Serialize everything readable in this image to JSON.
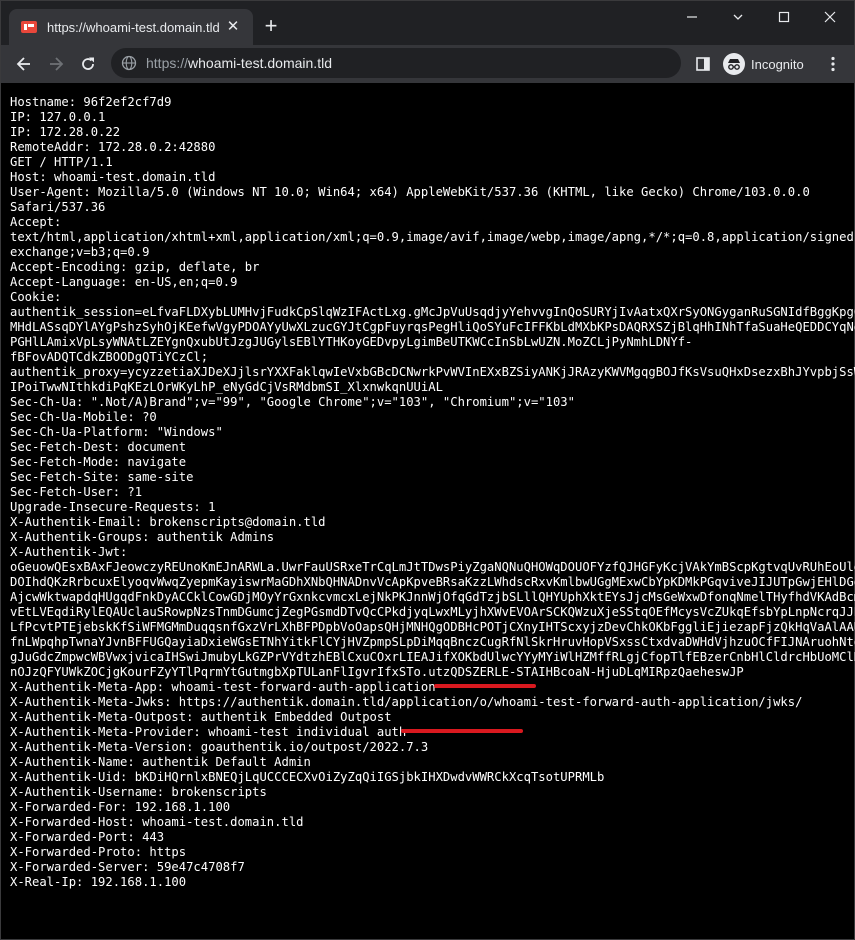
{
  "browser": {
    "tab_title": "https://whoami-test.domain.tld",
    "url_scheme": "https://",
    "url_host": "whoami-test.domain.tld",
    "profile_label": "Incognito",
    "accent_highlight": "#d9191f"
  },
  "response_lines": [
    "Hostname: 96f2ef2cf7d9",
    "IP: 127.0.0.1",
    "IP: 172.28.0.22",
    "RemoteAddr: 172.28.0.2:42880",
    "GET / HTTP/1.1",
    "Host: whoami-test.domain.tld",
    "User-Agent: Mozilla/5.0 (Windows NT 10.0; Win64; x64) AppleWebKit/537.36 (KHTML, like Gecko) Chrome/103.0.0.0",
    "Safari/537.36",
    "Accept:",
    "text/html,application/xhtml+xml,application/xml;q=0.9,image/avif,image/webp,image/apng,*/*;q=0.8,application/signed-",
    "exchange;v=b3;q=0.9",
    "Accept-Encoding: gzip, deflate, br",
    "Accept-Language: en-US,en;q=0.9",
    "Cookie:",
    "authentik_session=eLfvaFLDXybLUMHvjFudkCpSlqWzIFActLxg.gMcJpVuUsqdjyYehvvgInQoSURYjIvAatxQXrSyONGyganRuSGNIdfBggKpgCO",
    "MHdLASsqDYlAYgPshzSyhOjKEefwVgyPDOAYyUwXLzucGYJtCgpFuyrqsPegHliQoSYuFcIFFKbLdMXbKPsDAQRXSZjBlqHhINhTfaSuaHeQEDDCYqNeK",
    "PGHlLAmixVpLsyWNAtLZEYgnQxubUtJzgJUGylsEBlYTHKoyGEDvpyLgimBeUTKWCcInSbLwUZN.MoZCLjPyNmhLDNYf-",
    "fBFovADQTCdkZBOODgQTiYCzCl;",
    "authentik_proxy=ycyzzetiaXJDeXJjlsrYXXFaklqwIeVxbGBcDCNwrkPvWVInEXxBZSiyANKjJRAzyKWVMgqgBOJfKsVsuQHxDsezxBhJYvpbjSsWa",
    "IPoiTwwNIthkdiPqKEzLOrWKyLhP_eNyGdCjVsRMdbmSI_XlxnwkqnUUiAL",
    "Sec-Ch-Ua: \".Not/A)Brand\";v=\"99\", \"Google Chrome\";v=\"103\", \"Chromium\";v=\"103\"",
    "Sec-Ch-Ua-Mobile: ?0",
    "Sec-Ch-Ua-Platform: \"Windows\"",
    "Sec-Fetch-Dest: document",
    "Sec-Fetch-Mode: navigate",
    "Sec-Fetch-Site: same-site",
    "Sec-Fetch-User: ?1",
    "Upgrade-Insecure-Requests: 1",
    "X-Authentik-Email: brokenscripts@domain.tld",
    "X-Authentik-Groups: authentik Admins",
    "X-Authentik-Jwt:",
    "oGeuowQEsxBAxFJeowczyREUnoKmEJnARWLa.UwrFauUSRxeTrCqLmJtTDwsPiyZgaNQNuQHOWqDOUOFYzfQJHGFyKcjVAkYmBScpKgtvqUvRUhEoUlew",
    "DOIhdQKzRrbcuxElyoqvWwqZyepmKayiswrMaGDhXNbQHNADnvVcApKpveBRsaKzzLWhdscRxvKmlbwUGgMExwCbYpKDMkPGqviveJIJUTpGwjEHlDGqc",
    "AjcwWktwapdqHUgqdFnkDyACCklCowGDjMOyYrGxnkcvmcxLejNkPKJnnWjOfqGdTzjbSLllQHYUphXktEYsJjcMsGeWxwDfonqNmelTHyfhdVKAdBcmV",
    "vEtLVEqdiRylEQAUclauSRowpNzsTnmDGumcjZegPGsmdDTvQcCPkdjyqLwxMLyjhXWvEVOArSCKQWzuXjeSStqOEfMcysVcZUkqEfsbYpLnpNcrqJJPc",
    "LfPcvtPTEjebskKfSiWFMGMmDuqqsnfGxzVrLXhBFPDpbVoOapsQHjMNHQgODBHcPOTjCXnyIHTScxyjzDevChkOKbFggliEjiezapFjzQkHqVaAlAAUS",
    "fnLWpqhpTwnaYJvnBFFUGQayiaDxieWGsETNhYitkFlCYjHVZpmpSLpDiMqqBnczCugRfNlSkrHruvHopVSxssCtxdvaDWHdVjhzuOCfFIJNAruohNtof",
    "gJuGdcZmpwcWBVwxjvicaIHSwiJmubyLkGZPrVYdtzhEBlCxuCOxrLIEAJifXOKbdUlwcYYyMYiWlHZMffRLgjCfopTlfEBzerCnbHlCldrcHbUoMClDy",
    "nOJzQFYUWkZOCjgKourFZyYTlPqrmYtGutmgbXpTULanFlIgvrIfxSTo.utzQDSZERLE-STAIHBcoaN-HjuDLqMIRpzQaeheswJP",
    "X-Authentik-Meta-App: whoami-test-forward-auth-application",
    "X-Authentik-Meta-Jwks: https://authentik.domain.tld/application/o/whoami-test-forward-auth-application/jwks/",
    "X-Authentik-Meta-Outpost: authentik Embedded Outpost",
    "X-Authentik-Meta-Provider: whoami-test individual auth",
    "X-Authentik-Meta-Version: goauthentik.io/outpost/2022.7.3",
    "X-Authentik-Name: authentik Default Admin",
    "X-Authentik-Uid: bKDiHQrnlxBNEQjLqUCCCECXvOiZyZqQiIGSjbkIHXDwdvWWRCkXcqTsotUPRMLb",
    "X-Authentik-Username: brokenscripts",
    "X-Forwarded-For: 192.168.1.100",
    "X-Forwarded-Host: whoami-test.domain.tld",
    "X-Forwarded-Port: 443",
    "X-Forwarded-Proto: https",
    "X-Forwarded-Server: 59e47c4708f7",
    "X-Real-Ip: 192.168.1.100"
  ]
}
